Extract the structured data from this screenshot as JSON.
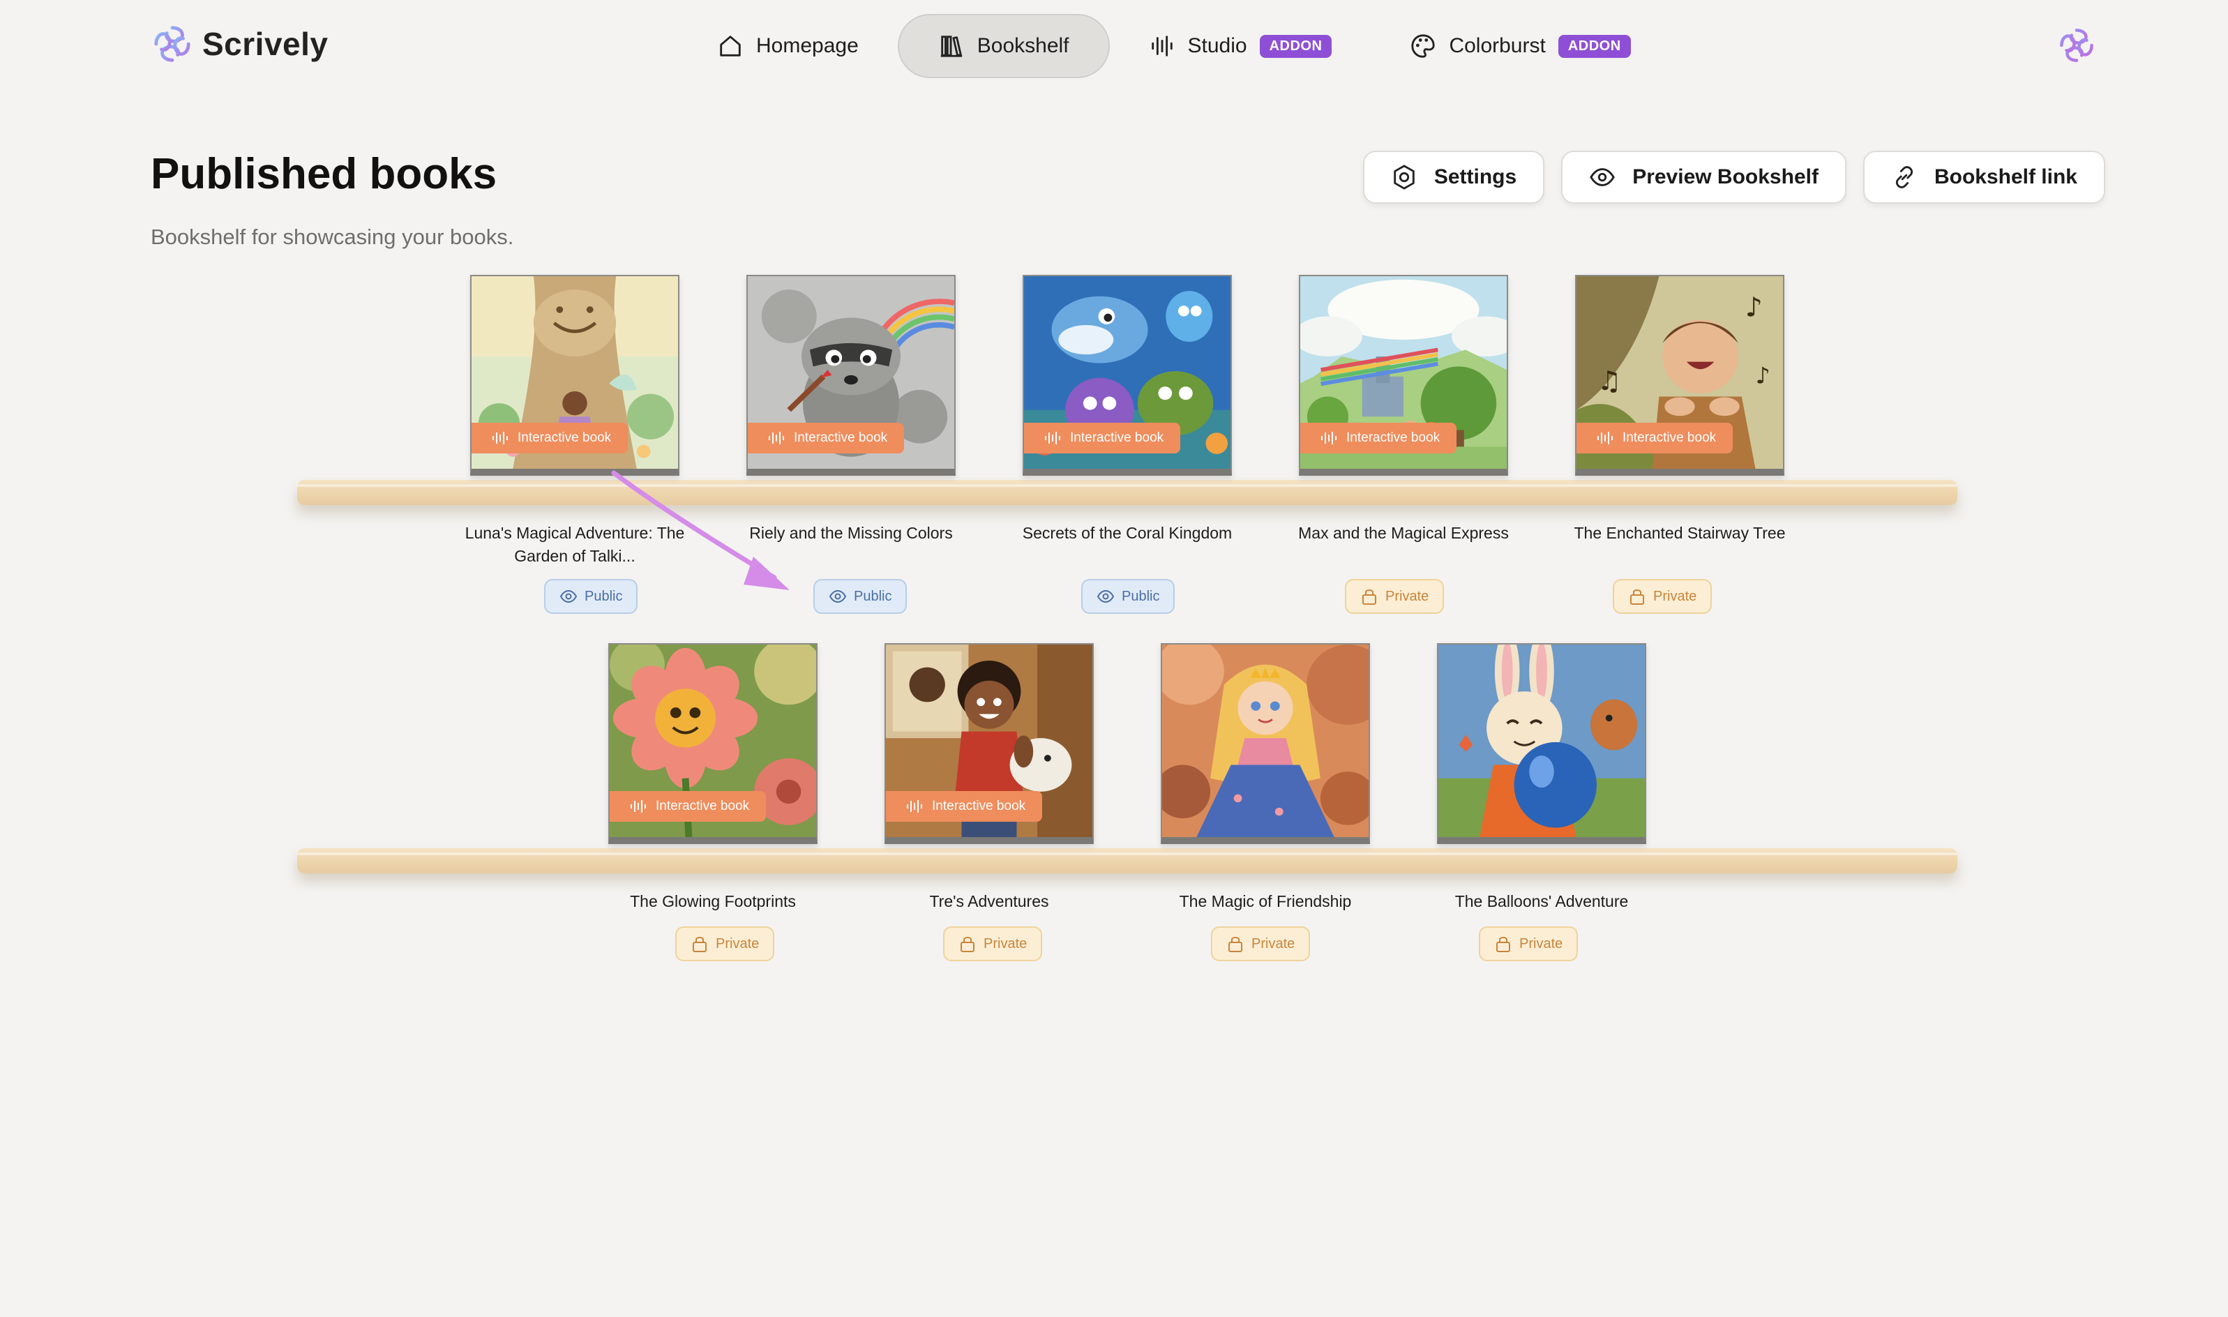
{
  "app": {
    "name": "Scrively"
  },
  "nav": {
    "items": [
      {
        "label": "Homepage",
        "icon": "home-icon",
        "active": false
      },
      {
        "label": "Bookshelf",
        "icon": "books-icon",
        "active": true
      },
      {
        "label": "Studio",
        "icon": "audio-wave-icon",
        "badge": "ADDON",
        "active": false
      },
      {
        "label": "Colorburst",
        "icon": "palette-icon",
        "badge": "ADDON",
        "active": false
      }
    ]
  },
  "page": {
    "title": "Published books",
    "subtitle": "Bookshelf for showcasing your books."
  },
  "actions": {
    "settings": "Settings",
    "preview": "Preview Bookshelf",
    "link": "Bookshelf link"
  },
  "badge_label": "Interactive book",
  "books": [
    {
      "title": "Luna's Magical Adventure: The Garden of Talki...",
      "status": "Public",
      "interactive": true,
      "cover": "tree"
    },
    {
      "title": "Riely and the Missing Colors",
      "status": "Public",
      "interactive": true,
      "cover": "raccoon"
    },
    {
      "title": "Secrets of the Coral Kingdom",
      "status": "Public",
      "interactive": true,
      "cover": "ocean"
    },
    {
      "title": "Max and the Magical Express",
      "status": "Private",
      "interactive": true,
      "cover": "train"
    },
    {
      "title": "The Enchanted Stairway Tree",
      "status": "Private",
      "interactive": true,
      "cover": "boy"
    },
    {
      "title": "The Glowing Footprints",
      "status": "Private",
      "interactive": true,
      "cover": "flower"
    },
    {
      "title": "Tre's Adventures",
      "status": "Private",
      "interactive": true,
      "cover": "kid"
    },
    {
      "title": "The Magic of Friendship",
      "status": "Private",
      "interactive": false,
      "cover": "princess"
    },
    {
      "title": "The Balloons' Adventure",
      "status": "Private",
      "interactive": false,
      "cover": "bunny"
    }
  ],
  "colors": {
    "accent": "#8e4fd6",
    "badge": "#ef8d5d",
    "public": "#4a6ea6",
    "private": "#c9853a",
    "background": "#f4f3f1"
  }
}
